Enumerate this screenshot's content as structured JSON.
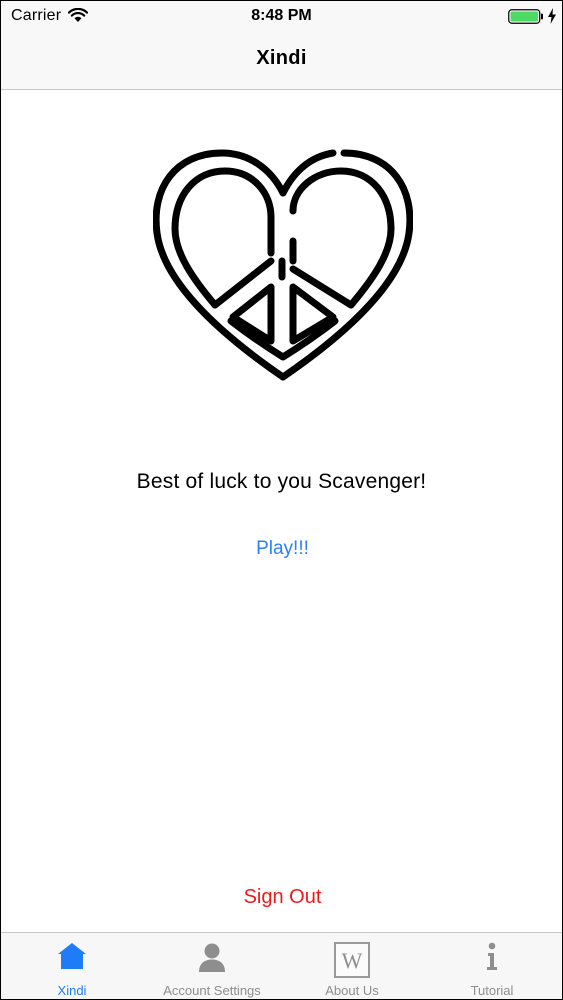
{
  "status_bar": {
    "carrier": "Carrier",
    "time": "8:48 PM",
    "icons": [
      "wifi-icon",
      "battery-icon",
      "charging-bolt-icon"
    ],
    "battery_color": "#4cd964"
  },
  "nav": {
    "title": "Xindi"
  },
  "main": {
    "logo_icon": "peace-heart-logo",
    "message": "Best of luck to you Scavenger!",
    "play_label": "Play!!!",
    "sign_out_label": "Sign Out"
  },
  "colors": {
    "accent": "#2a80f5",
    "danger": "#ee1a1a",
    "tab_active": "#1f7cf6",
    "tab_inactive": "#8e8e8e"
  },
  "tabs": [
    {
      "label": "Xindi",
      "icon": "home-icon",
      "active": true
    },
    {
      "label": "Account Settings",
      "icon": "person-icon",
      "active": false
    },
    {
      "label": "About Us",
      "icon": "wikipedia-icon",
      "active": false
    },
    {
      "label": "Tutorial",
      "icon": "info-icon",
      "active": false
    }
  ]
}
